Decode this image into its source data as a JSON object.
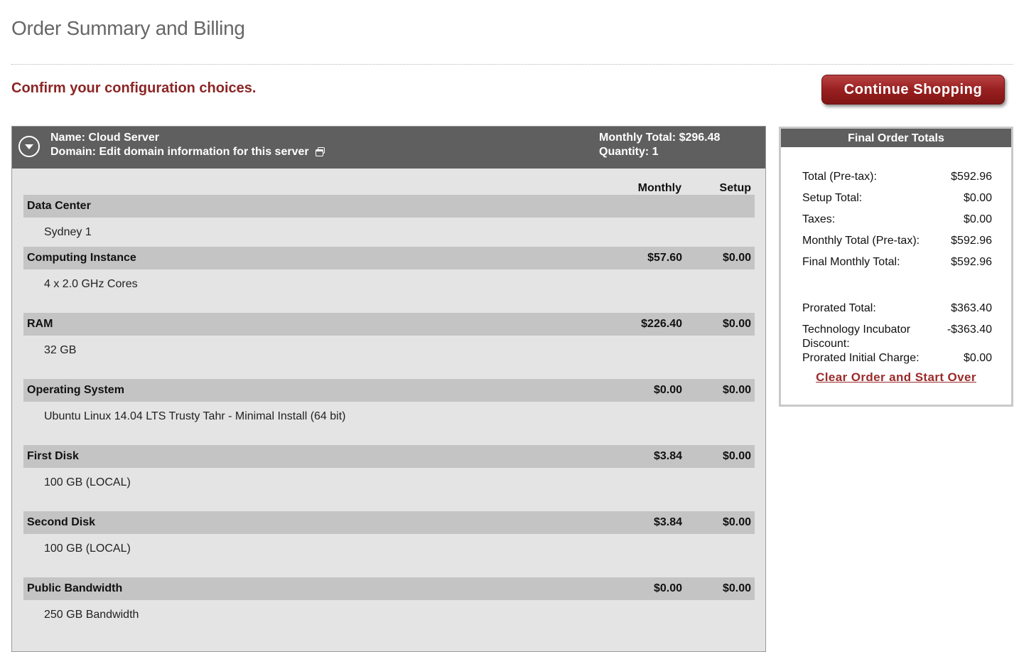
{
  "page": {
    "title": "Order Summary and Billing",
    "confirm_text": "Confirm your configuration choices.",
    "continue_button": "Continue Shopping"
  },
  "server": {
    "name_line": "Name: Cloud Server",
    "domain_line": "Domain: Edit domain information for this server",
    "monthly_total_line": "Monthly Total: $296.48",
    "quantity_line": "Quantity: 1",
    "columns": {
      "monthly": "Monthly",
      "setup": "Setup"
    },
    "sections": [
      {
        "category": "Data Center",
        "monthly": "",
        "setup": "",
        "item": "Sydney 1"
      },
      {
        "category": "Computing Instance",
        "monthly": "$57.60",
        "setup": "$0.00",
        "item": "4 x 2.0 GHz Cores"
      },
      {
        "category": "RAM",
        "monthly": "$226.40",
        "setup": "$0.00",
        "item": "32 GB"
      },
      {
        "category": "Operating System",
        "monthly": "$0.00",
        "setup": "$0.00",
        "item": "Ubuntu Linux 14.04 LTS Trusty Tahr - Minimal Install (64 bit)"
      },
      {
        "category": "First Disk",
        "monthly": "$3.84",
        "setup": "$0.00",
        "item": "100 GB (LOCAL)"
      },
      {
        "category": "Second Disk",
        "monthly": "$3.84",
        "setup": "$0.00",
        "item": "100 GB (LOCAL)"
      },
      {
        "category": "Public Bandwidth",
        "monthly": "$0.00",
        "setup": "$0.00",
        "item": "250 GB Bandwidth"
      }
    ]
  },
  "totals": {
    "header": "Final Order Totals",
    "rows": [
      {
        "label": "Total (Pre-tax):",
        "value": "$592.96"
      },
      {
        "label": "Setup Total:",
        "value": "$0.00"
      },
      {
        "label": "Taxes:",
        "value": "$0.00"
      },
      {
        "label": "Monthly Total (Pre-tax):",
        "value": "$592.96"
      },
      {
        "label": "Final Monthly Total:",
        "value": "$592.96"
      },
      {
        "label": "Prorated Total:",
        "value": "$363.40"
      },
      {
        "label": "Technology Incubator Discount:",
        "value": "-$363.40"
      },
      {
        "label": "Prorated Initial Charge:",
        "value": "$0.00"
      }
    ],
    "clear_link": "Clear Order and Start Over"
  }
}
